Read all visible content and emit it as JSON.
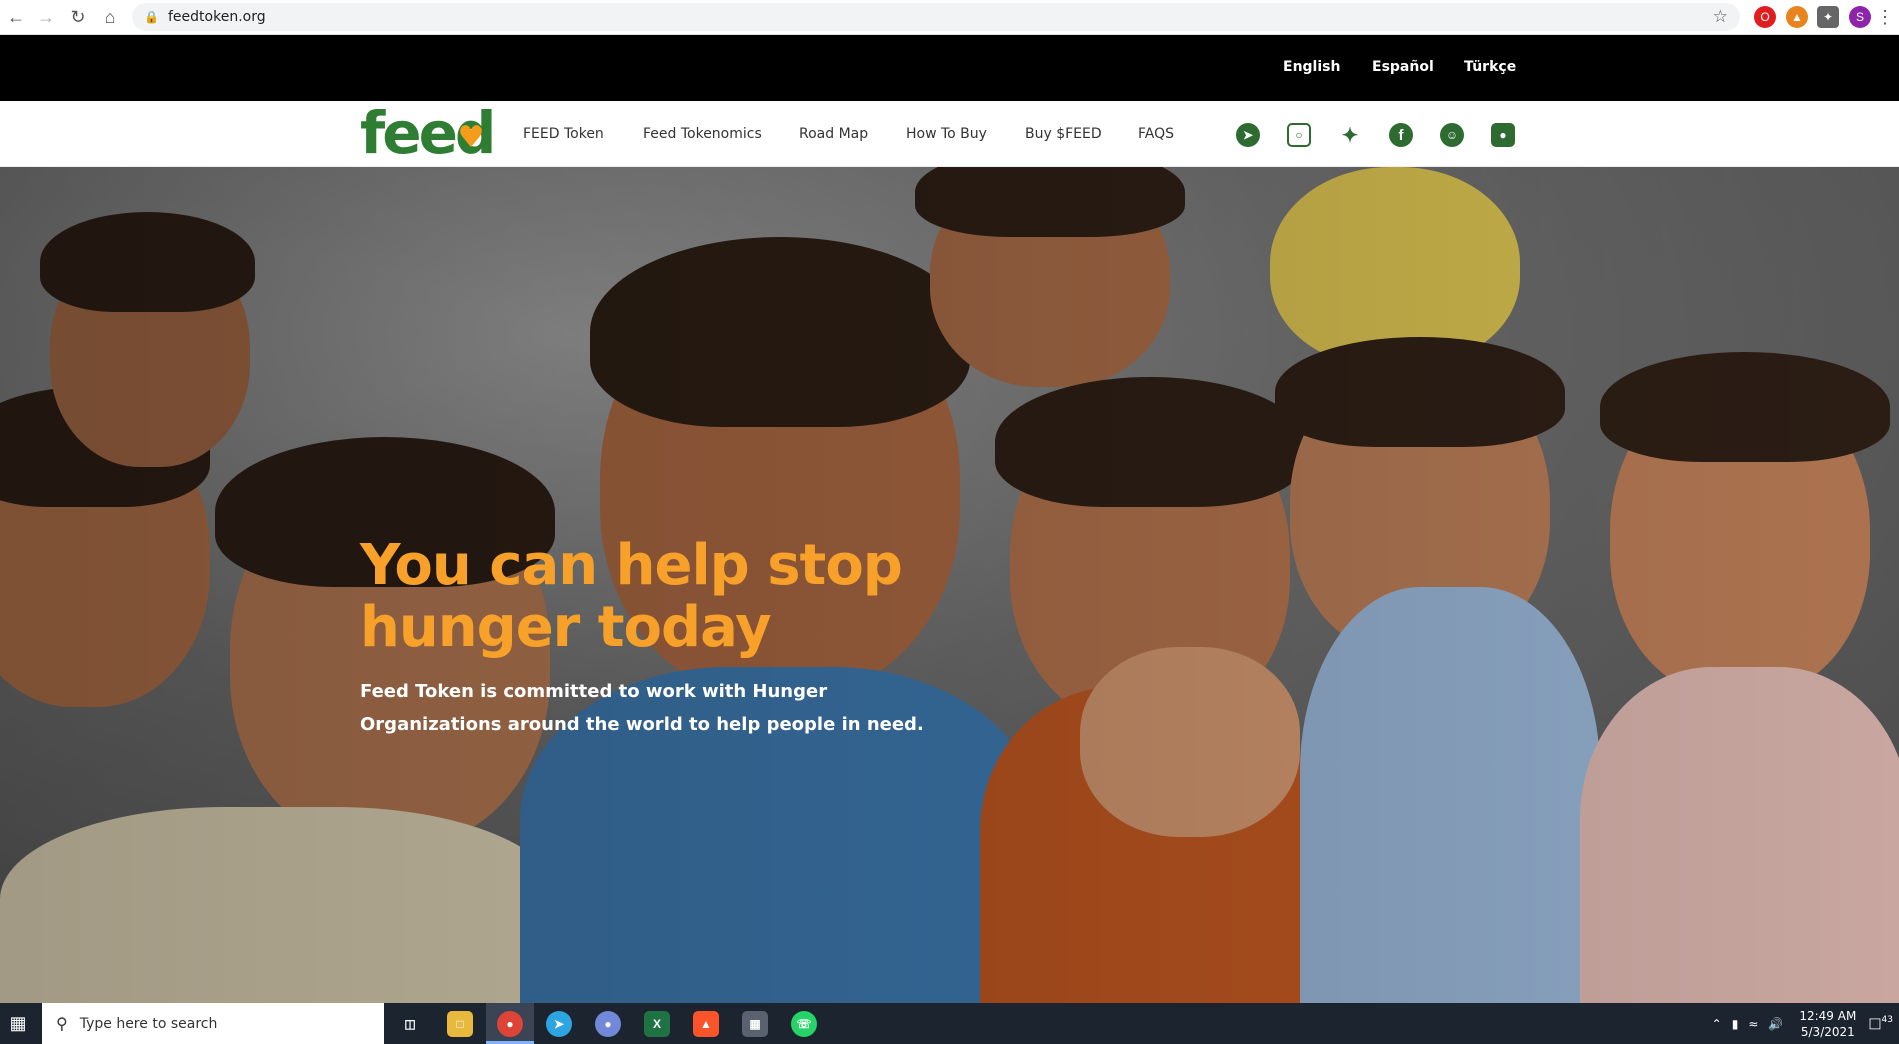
{
  "browser": {
    "url": "feedtoken.org",
    "back_icon": "arrow-left-icon",
    "forward_icon": "arrow-right-icon",
    "reload_icon": "reload-icon",
    "home_icon": "home-icon",
    "profile_initial": "S"
  },
  "lang_bar": {
    "languages": [
      "English",
      "Español",
      "Türkçe"
    ]
  },
  "nav": {
    "logo_text": "feed",
    "items": [
      "FEED Token",
      "Feed Tokenomics",
      "Road Map",
      "How To Buy",
      "Buy $FEED",
      "FAQS"
    ],
    "social_icons": [
      "telegram-icon",
      "instagram-icon",
      "twitter-icon",
      "facebook-icon",
      "reddit-icon",
      "discord-icon"
    ]
  },
  "hero": {
    "title": "You can help stop hunger today",
    "subtitle": "Feed Token is committed to work with Hunger Organizations around the world to help people in need."
  },
  "taskbar": {
    "search_placeholder": "Type here to search",
    "time": "12:49 AM",
    "date": "5/3/2021",
    "notification_count": "43"
  },
  "colors": {
    "brand_green": "#2e7d32",
    "accent_orange": "#f7a12b",
    "lang_bar_bg": "#000000"
  }
}
